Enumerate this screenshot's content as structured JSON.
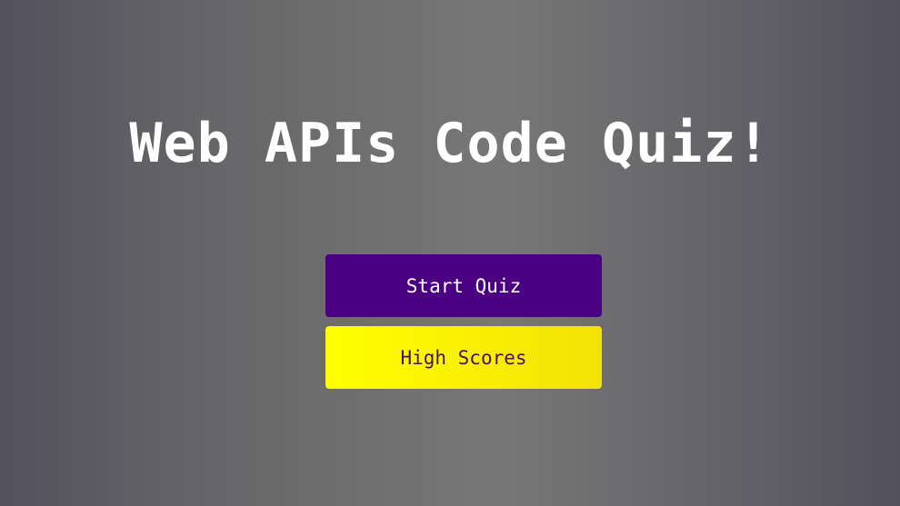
{
  "header": {
    "title": "Web APIs Code Quiz!"
  },
  "actions": {
    "start_label": "Start Quiz",
    "high_scores_label": "High Scores"
  },
  "colors": {
    "start_button": "#4b0082",
    "high_scores_button": "#ffff00",
    "title_text": "#ffffff"
  }
}
